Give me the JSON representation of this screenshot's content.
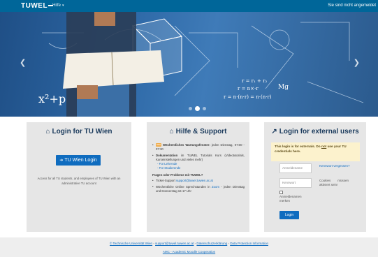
{
  "navbar": {
    "logo": "TUWEL",
    "help_label": "Hilfe",
    "login_status": "Sie sind nicht angemeldet"
  },
  "hero": {
    "prev_icon": "chevron-left-icon",
    "next_icon": "chevron-right-icon",
    "slide_count": 3,
    "active_slide": 2,
    "formula_lines": [
      "r = r₁ + r₂",
      "r = n×·r",
      "Mg",
      "r = n·(n·r) = n·(n·r)",
      "x²+p"
    ]
  },
  "panels": {
    "tu": {
      "title": "Login for TU Wien",
      "icon": "home-icon",
      "button_label": "TU Wien Login",
      "button_icon": "sign-in-icon",
      "description": "Access for all TU students, and employees of TU Wien with an administrative TU account"
    },
    "support": {
      "title": "Hilfe & Support",
      "icon": "home-icon",
      "badge": "neu",
      "item1_bold": "Wöchentliches Wartungsfenster:",
      "item1_text": "jeden Dienstag, 07:00 - 07:30",
      "item2_bold": "Dokumentation",
      "item2_text": "im TUWEL Tutorials Kurs (Videotutorials, Kurseinstellungen und vieles mehr)",
      "item2_link1": "- Für Lehrende",
      "item2_link2": "- Für Studierende",
      "questions_title": "Fragen oder Probleme mit TUWEL?",
      "ticket_label": "Ticket-Support",
      "ticket_email": "support@tuwel.tuwien.ac.at",
      "consult_prefix": "Wöchentliche Online Sprechstunden in",
      "consult_link": "Zoom",
      "consult_suffix": "- jeden Dienstag und Donnerstag 16-17 Uhr"
    },
    "external": {
      "title": "Login for external users",
      "icon": "external-link-icon",
      "notice_pre": "This login is for externals. Do",
      "notice_not": "not",
      "notice_post": "use your TU credentials here.",
      "username_placeholder": "Anmeldename",
      "password_placeholder": "Kennwort",
      "forgot_link": "Kennwort vergessen?",
      "cookies_note": "Cookies müssen aktiviert sein!",
      "remember_label": "Anmeldenamen merken",
      "login_button": "Login"
    }
  },
  "footer": {
    "copyright": "© Technische Universität Wien",
    "sep": " - ",
    "email": "support@tuwel.tuwien.ac.at",
    "privacy": "Datenschutzerklärung",
    "dpi": "Data Protection Information",
    "amc": "AMC - Academic Moodle Cooperation"
  },
  "colors": {
    "navbar": "#006699",
    "accent": "#0f6cbf",
    "panel_bg": "#e6e6e6",
    "notice_bg": "#fcf2cd"
  }
}
